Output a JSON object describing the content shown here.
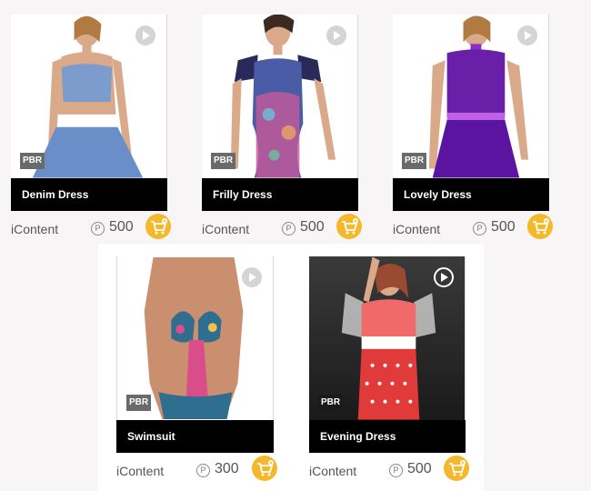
{
  "products": [
    {
      "name": "Denim Dress",
      "vendor": "iContent",
      "currency_symbol": "P",
      "price": "500",
      "badge": "PBR",
      "top_color": "#7b9ccc",
      "bottom_color": "#6a8fc8"
    },
    {
      "name": "Frilly Dress",
      "vendor": "iContent",
      "currency_symbol": "P",
      "price": "500",
      "badge": "PBR",
      "top_color": "#4a5ca6",
      "bottom_color": "#c65a9a"
    },
    {
      "name": "Lovely Dress",
      "vendor": "iContent",
      "currency_symbol": "P",
      "price": "500",
      "badge": "PBR",
      "top_color": "#6a1fa8",
      "bottom_color": "#5a14a0"
    },
    {
      "name": "Swimsuit",
      "vendor": "iContent",
      "currency_symbol": "P",
      "price": "300",
      "badge": "PBR",
      "top_color": "#2f6e8f",
      "bottom_color": "#d94d8a"
    },
    {
      "name": "Evening Dress",
      "vendor": "iContent",
      "currency_symbol": "P",
      "price": "500",
      "badge": "PBR",
      "top_color": "#ef5a5a",
      "bottom_color": "#e13a3a"
    }
  ],
  "icons": {
    "play": "play-icon",
    "cart": "add-to-cart-icon",
    "currency": "points-coin-icon"
  },
  "colors": {
    "cart": "#f4b82b",
    "title_bar": "#000000",
    "badge": "#6a6a6a"
  }
}
